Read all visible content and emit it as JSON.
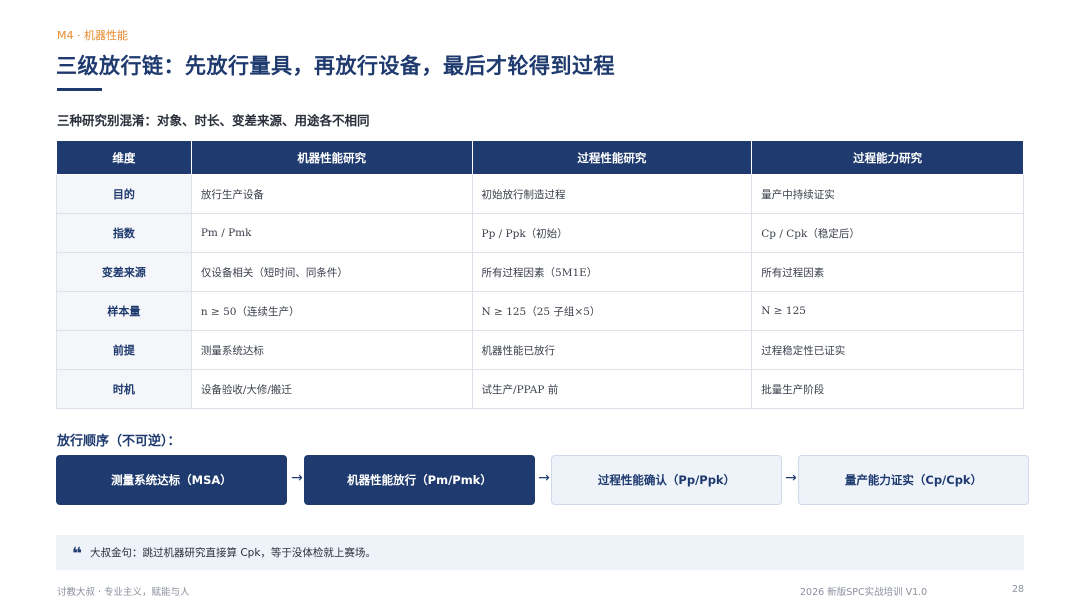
{
  "header": {
    "module_tag": "M4 · 机器性能",
    "title": "三级放行链：先放行量具，再放行设备，最后才轮得到过程",
    "subtitle": "三种研究别混淆：对象、时长、变差来源、用途各不相同"
  },
  "table": {
    "headers": [
      "维度",
      "机器性能研究",
      "过程性能研究",
      "过程能力研究"
    ],
    "rows": [
      [
        "目的",
        "放行生产设备",
        "初始放行制造过程",
        "量产中持续证实"
      ],
      [
        "指数",
        "Pm / Pmk",
        "Pp / Ppk（初始）",
        "Cp / Cpk（稳定后）"
      ],
      [
        "变差来源",
        "仅设备相关（短时间、同条件）",
        "所有过程因素（5M1E）",
        "所有过程因素"
      ],
      [
        "样本量",
        "n ≥ 50（连续生产）",
        "N ≥ 125（25 子组×5）",
        "N ≥ 125"
      ],
      [
        "前提",
        "测量系统达标",
        "机器性能已放行",
        "过程稳定性已证实"
      ],
      [
        "时机",
        "设备验收/大修/搬迁",
        "试生产/PPAP 前",
        "批量生产阶段"
      ]
    ]
  },
  "flow": {
    "heading": "放行顺序（不可逆）：",
    "arrow": "→",
    "steps": [
      {
        "label": "测量系统达标（MSA）",
        "style": "dark"
      },
      {
        "label": "机器性能放行（Pm/Pmk）",
        "style": "dark"
      },
      {
        "label": "过程性能确认（Pp/Ppk）",
        "style": "light"
      },
      {
        "label": "量产能力证实（Cp/Cpk）",
        "style": "light"
      }
    ]
  },
  "quote": {
    "icon": "quote-mark-icon",
    "icon_glyph": "❝",
    "text": "大叔金句：跳过机器研究直接算 Cpk，等于没体检就上赛场。"
  },
  "footer": {
    "left": "讨教大叔 · 专业主义，赋能与人",
    "right": "2026 新版SPC实战培训 V1.0",
    "page": "28"
  },
  "colors": {
    "primary": "#1e3a6e",
    "accent": "#e8892b",
    "light_bg": "#eef3fa"
  }
}
